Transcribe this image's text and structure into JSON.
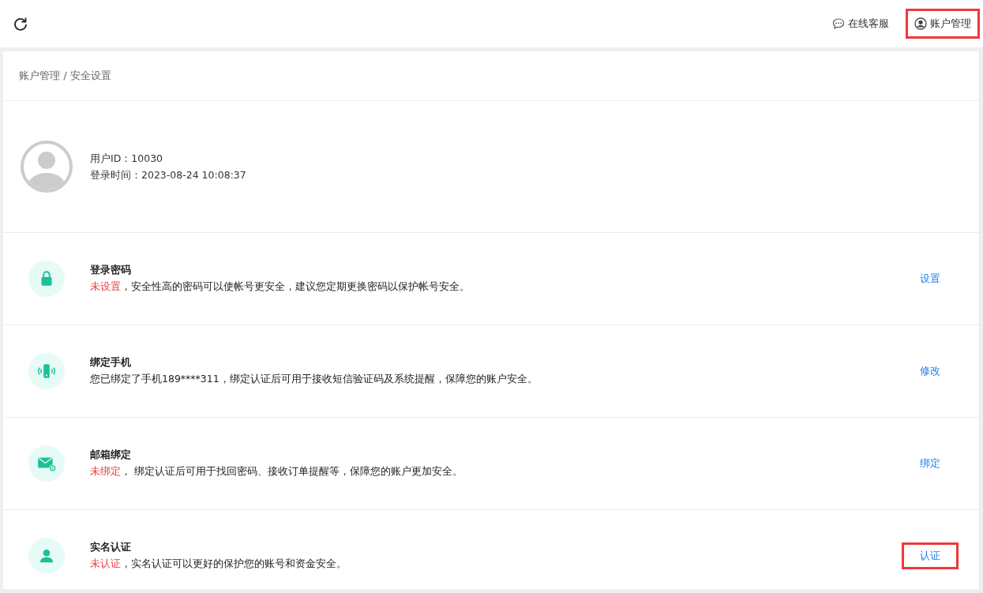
{
  "top_bar": {
    "links": [
      {
        "kind": "chat",
        "label": "在线客服",
        "highlighted": false
      },
      {
        "kind": "user",
        "label": "账户管理",
        "highlighted": true
      }
    ]
  },
  "breadcrumb": "账户管理 / 安全设置",
  "profile": {
    "lines": [
      "用户ID：10030",
      "登录时间：2023-08-24 10:08:37"
    ]
  },
  "security_items": [
    {
      "kind": "lock",
      "title": "登录密码",
      "status": "未设置",
      "text": "，安全性高的密码可以使帐号更安全，建议您定期更换密码以保护帐号安全。",
      "action": "设置",
      "highlighted": false
    },
    {
      "kind": "phone",
      "title": "绑定手机",
      "text": "您已绑定了手机189****311，绑定认证后可用于接收短信验证码及系统提醒，保障您的账户安全。",
      "action": "修改",
      "highlighted": false
    },
    {
      "kind": "mail",
      "title": "邮箱绑定",
      "status": "未绑定",
      "text": "， 绑定认证后可用于找回密码、接收订单提醒等，保障您的账户更加安全。",
      "action": "绑定",
      "highlighted": false
    },
    {
      "kind": "person",
      "title": "实名认证",
      "status": "未认证",
      "text": "，实名认证可以更好的保护您的账号和资金安全。",
      "action": "认证",
      "highlighted": true
    }
  ]
}
